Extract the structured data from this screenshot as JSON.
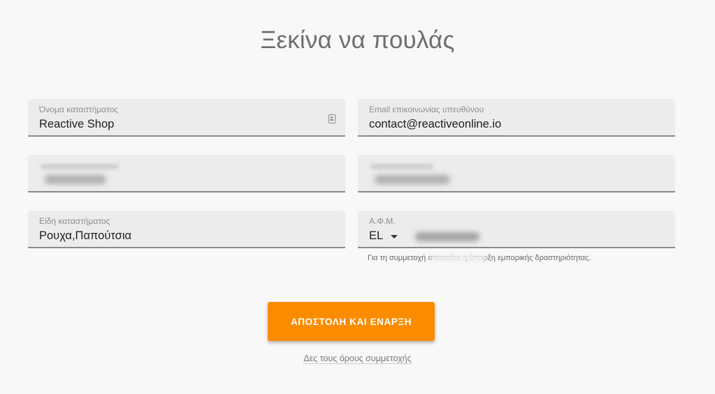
{
  "page": {
    "title": "Ξεκίνα να πουλάς"
  },
  "form": {
    "store_name": {
      "label": "Όνομα καταστήματος",
      "value": "Reactive Shop"
    },
    "contact_email": {
      "label": "Email επικοινωνίας υπευθύνου",
      "value": "contact@reactiveonline.io"
    },
    "surname": {
      "label_blurred": true,
      "value_blurred": true
    },
    "phone": {
      "label_blurred": true,
      "value_blurred": true
    },
    "store_types": {
      "label": "Είδη καταστήματος",
      "value": "Ρουχα,Παπούτσια"
    },
    "vat": {
      "label": "Α.Φ.Μ.",
      "country_code": "EL",
      "value_blurred": true
    },
    "hint_text": "Για τη συμμετοχή απαιτείται η ύπαρξη εμπορικής δραστηριότητας.",
    "submit_label": "ΑΠΟΣΤΟΛΗ ΚΑΙ ΕΝΑΡΞΗ",
    "terms_link": "Δες τους όρους συμμετοχής"
  },
  "icons": {
    "store_name_field": "id-card-icon",
    "country_select": "chevron-down-icon"
  },
  "colors": {
    "accent": "#fb8c00",
    "background": "#f8f8f8",
    "field_background": "#ececec"
  }
}
